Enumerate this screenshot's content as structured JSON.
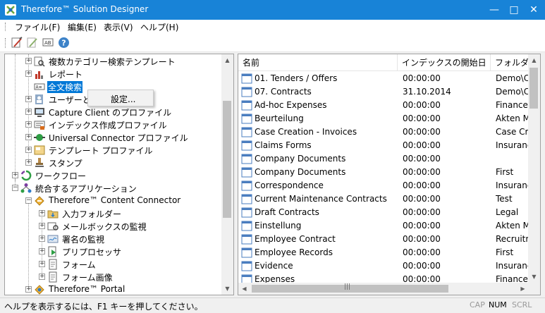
{
  "window": {
    "title": "Therefore™ Solution Designer"
  },
  "menu": [
    "ファイル(F)",
    "編集(E)",
    "表示(V)",
    "ヘルプ(H)"
  ],
  "toolbar": [
    "brush-icon",
    "brush-grey-icon",
    "find-icon",
    "help-icon"
  ],
  "tree": {
    "items": [
      {
        "label": "複数カテゴリー検索テンプレート",
        "icon": "multi-search-icon"
      },
      {
        "label": "レポート",
        "icon": "report-icon"
      },
      {
        "label": "全文検索",
        "icon": "fulltext-icon",
        "selected": true
      },
      {
        "label": "ユーザーと",
        "icon": "users-icon"
      },
      {
        "label": "Capture Client のプロファイル",
        "icon": "capture-client-icon"
      },
      {
        "label": "インデックス作成プロファイル",
        "icon": "indexing-icon"
      },
      {
        "label": "Universal Connector プロファイル",
        "icon": "universal-connector-icon"
      },
      {
        "label": "テンプレート プロファイル",
        "icon": "template-icon"
      },
      {
        "label": "スタンプ",
        "icon": "stamp-icon"
      },
      {
        "label": "ワークフロー",
        "icon": "workflow-icon"
      },
      {
        "label": "統合するアプリケーション",
        "icon": "integration-icon"
      },
      {
        "label": "Therefore™ Content Connector",
        "icon": "content-connector-icon"
      },
      {
        "label": "入力フォルダー",
        "icon": "input-folder-icon"
      },
      {
        "label": "メールボックスの監視",
        "icon": "mailbox-icon"
      },
      {
        "label": "署名の監視",
        "icon": "signature-icon"
      },
      {
        "label": "プリプロセッサ",
        "icon": "preprocessor-icon"
      },
      {
        "label": "フォーム",
        "icon": "form-icon"
      },
      {
        "label": "フォーム画像",
        "icon": "form-image-icon"
      },
      {
        "label": "Therefore™ Portal",
        "icon": "portal-icon"
      }
    ]
  },
  "context_menu": {
    "item": "設定..."
  },
  "list": {
    "columns": [
      "名前",
      "インデックスの開始日",
      "フォルダ"
    ],
    "rows": [
      [
        "01. Tenders / Offers",
        "00:00:00",
        "Demo\\Ca"
      ],
      [
        "07. Contracts",
        "31.10.2014",
        "Demo\\Ca"
      ],
      [
        "Ad-hoc Expenses",
        "00:00:00",
        "Finance"
      ],
      [
        "Beurteilung",
        "00:00:00",
        "Akten Ma"
      ],
      [
        "Case Creation - Invoices",
        "00:00:00",
        "Case Cre"
      ],
      [
        "Claims Forms",
        "00:00:00",
        "Insurance"
      ],
      [
        "Company Documents",
        "00:00:00",
        ""
      ],
      [
        "Company Documents",
        "00:00:00",
        "First"
      ],
      [
        "Correspondence",
        "00:00:00",
        "Insurance"
      ],
      [
        "Current Maintenance Contracts",
        "00:00:00",
        "Test"
      ],
      [
        "Draft Contracts",
        "00:00:00",
        "Legal"
      ],
      [
        "Einstellung",
        "00:00:00",
        "Akten Ma"
      ],
      [
        "Employee Contract",
        "00:00:00",
        "Recruitm"
      ],
      [
        "Employee Records",
        "00:00:00",
        "First"
      ],
      [
        "Evidence",
        "00:00:00",
        "Insurance"
      ],
      [
        "Expenses",
        "00:00:00",
        "Finance"
      ]
    ]
  },
  "status": {
    "message": "ヘルプを表示するには、F1 キーを押してください。",
    "indicators": [
      {
        "label": "CAP",
        "active": false
      },
      {
        "label": "NUM",
        "active": true
      },
      {
        "label": "SCRL",
        "active": false
      }
    ]
  },
  "colors": {
    "titlebar": "#1883d7",
    "selection": "#0078d7",
    "folder": "#4a7dbf"
  }
}
